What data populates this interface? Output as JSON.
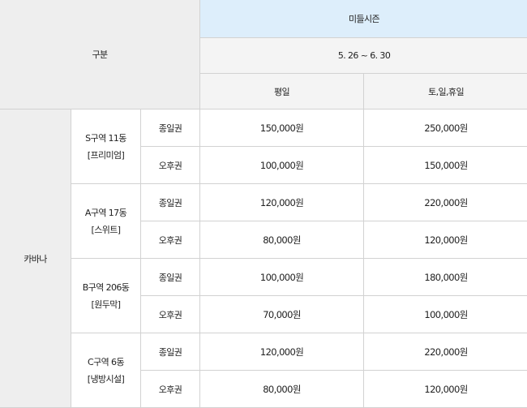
{
  "header": {
    "category_label": "구분",
    "season": "미들시즌",
    "dates": "5. 26 ~ 6. 30",
    "weekday": "평일",
    "weekend": "토,일,휴일"
  },
  "category": "카바나",
  "zones": [
    {
      "name": "S구역 11동",
      "note": "[프리미엄]",
      "rows": [
        {
          "type": "종일권",
          "weekday": "150,000원",
          "weekend": "250,000원"
        },
        {
          "type": "오후권",
          "weekday": "100,000원",
          "weekend": "150,000원"
        }
      ]
    },
    {
      "name": "A구역 17동",
      "note": "[스위트]",
      "rows": [
        {
          "type": "종일권",
          "weekday": "120,000원",
          "weekend": "220,000원"
        },
        {
          "type": "오후권",
          "weekday": "80,000원",
          "weekend": "120,000원"
        }
      ]
    },
    {
      "name": "B구역 206동",
      "note": "[원두막]",
      "rows": [
        {
          "type": "종일권",
          "weekday": "100,000원",
          "weekend": "180,000원"
        },
        {
          "type": "오후권",
          "weekday": "70,000원",
          "weekend": "100,000원"
        }
      ]
    },
    {
      "name": "C구역 6동",
      "note": "[냉방시설]",
      "rows": [
        {
          "type": "종일권",
          "weekday": "120,000원",
          "weekend": "220,000원"
        },
        {
          "type": "오후권",
          "weekday": "80,000원",
          "weekend": "120,000원"
        }
      ]
    }
  ]
}
